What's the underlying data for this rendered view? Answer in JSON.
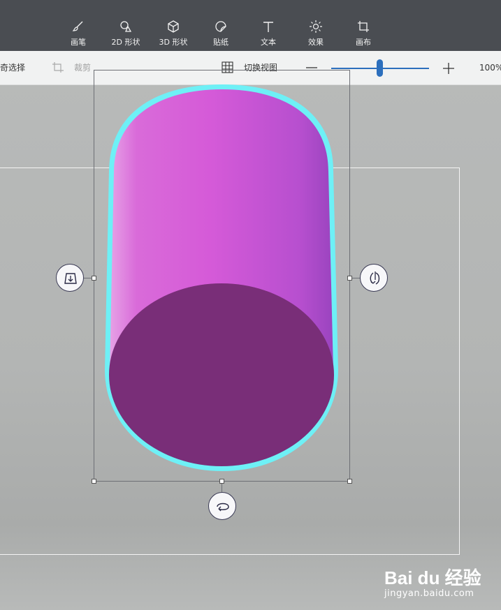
{
  "toolbar": {
    "items": [
      {
        "label": "画笔",
        "icon": "brush-icon"
      },
      {
        "label": "2D 形状",
        "icon": "shapes-2d-icon"
      },
      {
        "label": "3D 形状",
        "icon": "cube-3d-icon"
      },
      {
        "label": "贴纸",
        "icon": "sticker-icon"
      },
      {
        "label": "文本",
        "icon": "text-icon"
      },
      {
        "label": "效果",
        "icon": "effects-sun-icon"
      },
      {
        "label": "画布",
        "icon": "canvas-crop-icon"
      }
    ]
  },
  "subbar": {
    "magic_select": "奇选择",
    "crop": "裁剪",
    "switch_view": "切换视图",
    "zoom_minus": "—",
    "zoom_plus": "+",
    "zoom_level": "100%"
  },
  "watermark": {
    "logo": "Bai du 经验",
    "url": "jingyan.baidu.com"
  },
  "colors": {
    "toolbar_bg": "#4a4d52",
    "accent": "#2c6fbd",
    "cylinder_top": "#d458d8",
    "cylinder_face": "#792e78",
    "selection_glow": "#6ef0f6"
  }
}
